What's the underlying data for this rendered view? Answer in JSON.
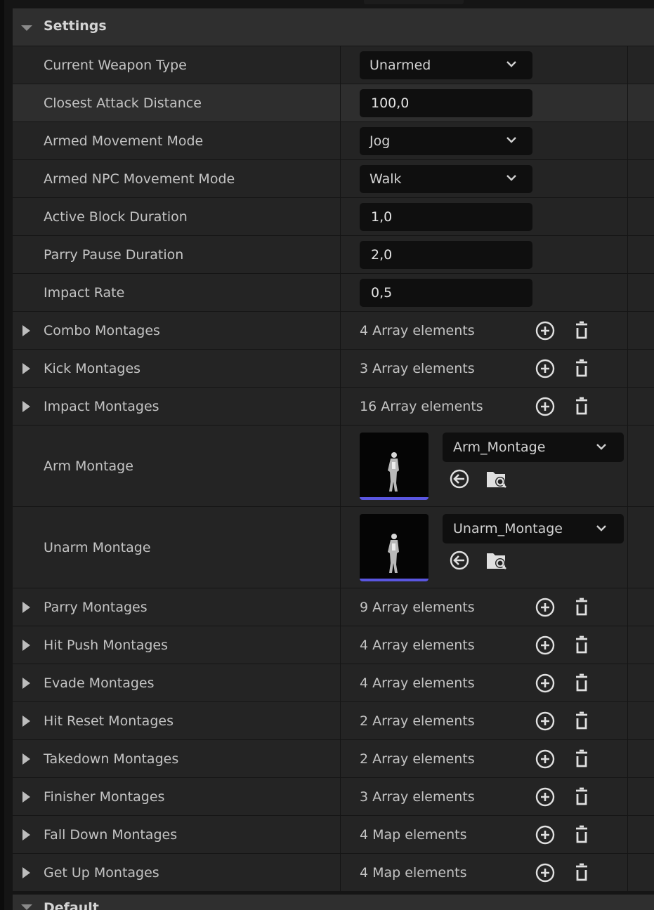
{
  "category": {
    "title": "Settings"
  },
  "next_category": {
    "title": "Default"
  },
  "properties": {
    "current_weapon_type": {
      "label": "Current Weapon Type",
      "value": "Unarmed"
    },
    "closest_attack_distance": {
      "label": "Closest Attack Distance",
      "value": "100,0"
    },
    "armed_movement_mode": {
      "label": "Armed Movement Mode",
      "value": "Jog"
    },
    "armed_npc_movement_mode": {
      "label": "Armed NPC Movement Mode",
      "value": "Walk"
    },
    "active_block_duration": {
      "label": "Active Block Duration",
      "value": "1,0"
    },
    "parry_pause_duration": {
      "label": "Parry Pause Duration",
      "value": "2,0"
    },
    "impact_rate": {
      "label": "Impact Rate",
      "value": "0,5"
    },
    "combo_montages": {
      "label": "Combo Montages",
      "value": "4 Array elements"
    },
    "kick_montages": {
      "label": "Kick Montages",
      "value": "3 Array elements"
    },
    "impact_montages": {
      "label": "Impact Montages",
      "value": "16 Array elements"
    },
    "arm_montage": {
      "label": "Arm Montage",
      "value": "Arm_Montage"
    },
    "unarm_montage": {
      "label": "Unarm Montage",
      "value": "Unarm_Montage"
    },
    "parry_montages": {
      "label": "Parry Montages",
      "value": "9 Array elements"
    },
    "hit_push_montages": {
      "label": "Hit Push Montages",
      "value": "4 Array elements"
    },
    "evade_montages": {
      "label": "Evade Montages",
      "value": "4 Array elements"
    },
    "hit_reset_montages": {
      "label": "Hit Reset Montages",
      "value": "2 Array elements"
    },
    "takedown_montages": {
      "label": "Takedown Montages",
      "value": "2 Array elements"
    },
    "finisher_montages": {
      "label": "Finisher Montages",
      "value": "3 Array elements"
    },
    "fall_down_montages": {
      "label": "Fall Down Montages",
      "value": "4 Map elements"
    },
    "get_up_montages": {
      "label": "Get Up Montages",
      "value": "4 Map elements"
    }
  },
  "icons": {
    "category_arrow": "triangle-down-icon",
    "expander": "triangle-right-icon",
    "dropdown": "chevron-down-icon",
    "add": "plus-circle-icon",
    "delete": "trash-icon",
    "use_selected": "arrow-left-circle-icon",
    "browse": "browse-asset-icon"
  },
  "colors": {
    "background": "#151515",
    "row": "#242424",
    "row_hover": "#2e2e2e",
    "header": "#2f2f2f",
    "field": "#0f0f0f",
    "thumbnail_accent": "#5a56e0"
  }
}
